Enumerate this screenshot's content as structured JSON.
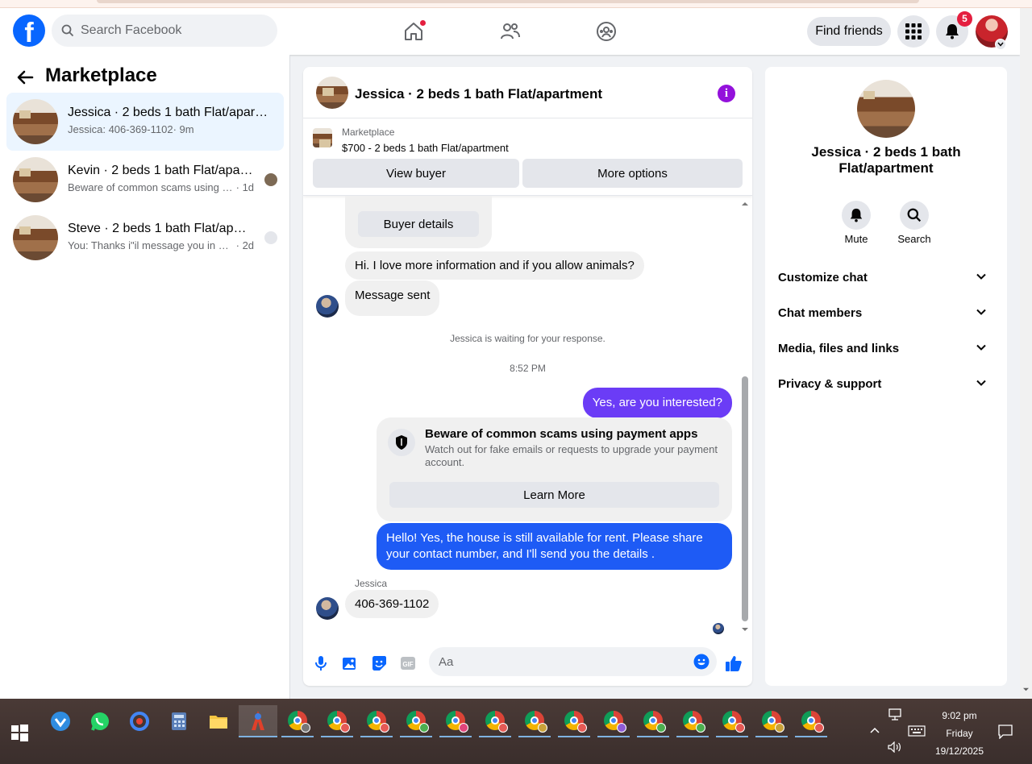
{
  "header": {
    "search_placeholder": "Search Facebook",
    "find_friends_label": "Find friends",
    "notification_count": "5",
    "colors": {
      "brand": "#0866ff",
      "badge": "#e41e3f"
    }
  },
  "sidebar": {
    "title": "Marketplace",
    "conversations": [
      {
        "name": "Jessica · 2 beds 1 bath Flat/apartm...",
        "preview": "Jessica: 406-369-1102",
        "time": "· 9m"
      },
      {
        "name": "Kevin · 2 beds 1 bath Flat/apart...",
        "preview": "Beware of common scams using p...",
        "time": "· 1d"
      },
      {
        "name": "Steve · 2 beds 1 bath Flat/apart...",
        "preview": "You: Thanks i\"il message you in a ...",
        "time": "· 2d"
      }
    ]
  },
  "chat": {
    "title": "Jessica · 2 beds 1 bath Flat/apartment",
    "listing_label": "Marketplace",
    "listing_price": "$700 - 2 beds 1 bath Flat/apartment",
    "view_buyer_label": "View buyer",
    "more_options_label": "More options",
    "buyer_details_label": "Buyer details",
    "messages": {
      "in_1": "Hi. I love more information and if you allow animals?",
      "in_2": "Message sent",
      "waiting": "Jessica is waiting for your response.",
      "time": "8:52 PM",
      "out_1": "Yes, are you interested?",
      "out_2": "Hello! Yes, the house is still available for rent. Please share your contact number, and I'll send you the details .",
      "sender": "Jessica",
      "in_3": "406-369-1102"
    },
    "scam_card": {
      "title": "Beware of common scams using payment apps",
      "text": "Watch out for fake emails or requests to upgrade your payment account.",
      "button": "Learn More"
    },
    "composer_placeholder": "Aa",
    "colors": {
      "outgoing": "#0a7cff",
      "outgoing_top": "#6b3cf6",
      "accent": "#9311db"
    }
  },
  "details": {
    "title": "Jessica · 2 beds 1 bath Flat/apartment",
    "mute_label": "Mute",
    "search_label": "Search",
    "sections": [
      "Customize chat",
      "Chat members",
      "Media, files and links",
      "Privacy & support"
    ]
  },
  "taskbar": {
    "time": "9:02 pm",
    "day": "Friday",
    "date": "19/12/2025"
  }
}
